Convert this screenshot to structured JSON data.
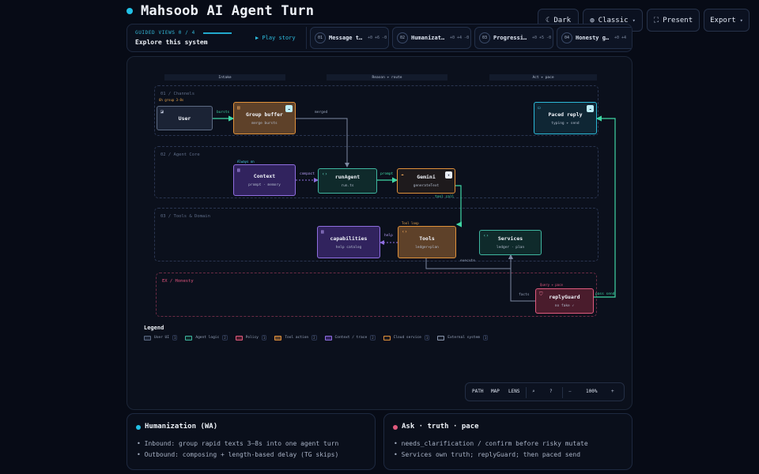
{
  "header": {
    "title": "Mahsoob AI Agent Turn",
    "theme_label": "Dark",
    "style_label": "Classic",
    "present_label": "Present",
    "export_label": "Export"
  },
  "guided": {
    "label": "GUIDED VIEWS",
    "counter": "0 / 4",
    "title": "Explore this system",
    "play_label": "Play story",
    "views": [
      {
        "num": "01",
        "label": "Message to...",
        "stat": "+0 +6 -0"
      },
      {
        "num": "02",
        "label": "Humanizati...",
        "stat": "+0 +4 -0"
      },
      {
        "num": "03",
        "label": "Progressiv...",
        "stat": "+0 +5 -0"
      },
      {
        "num": "04",
        "label": "Honesty ga...",
        "stat": "+0 +4"
      }
    ]
  },
  "diagram": {
    "columns": [
      "Intake",
      "Reason + route",
      "Act + pace"
    ],
    "lanes": {
      "channels": "01 / Channels",
      "core": "02 / Agent Core",
      "tools": "03 / Tools & Domain",
      "honesty": "EX / Honesty"
    },
    "lane_notes": {
      "group": "6h group 3-8s",
      "always_on": "Always on",
      "tool_loop": "Tool loop",
      "query_pace": "Query + pace"
    },
    "nodes": {
      "user": {
        "title": "User",
        "sub": ""
      },
      "group_buffer": {
        "title": "Group buffer",
        "sub": "merge bursts"
      },
      "paced_reply": {
        "title": "Paced reply",
        "sub": "typing + send"
      },
      "context": {
        "title": "Context",
        "sub": "prompt · memory"
      },
      "run_agent": {
        "title": "runAgent",
        "sub": "run.ts"
      },
      "gemini": {
        "title": "Gemini",
        "sub": "generateText"
      },
      "capabilities": {
        "title": "capabilities",
        "sub": "help catalog"
      },
      "tools": {
        "title": "Tools",
        "sub": "ledger+plan"
      },
      "services": {
        "title": "Services",
        "sub": "ledger · plan"
      },
      "reply_guard": {
        "title": "replyGuard",
        "sub": "no fake ✓"
      }
    },
    "edge_labels": {
      "bursts": "bursts",
      "merged": "merged",
      "compact": "compact",
      "prompt": "prompt",
      "tool_call": "tool call",
      "help": "help",
      "execute": "execute",
      "facts": "facts",
      "pass_send": "pass send"
    }
  },
  "legend": {
    "title": "Legend",
    "items": [
      {
        "label": "User UI",
        "count": "1",
        "color": "#5d6b84"
      },
      {
        "label": "Agent logic",
        "count": "2",
        "color": "#3fb6a0"
      },
      {
        "label": "Policy",
        "count": "1",
        "color": "#e05a7e"
      },
      {
        "label": "Tool action",
        "count": "2",
        "color": "#e0913a"
      },
      {
        "label": "Context / trace",
        "count": "2",
        "color": "#8f6ee0"
      },
      {
        "label": "Cloud service",
        "count": "1",
        "color": "#e0913a"
      },
      {
        "label": "External system",
        "count": "1",
        "color": "#8a96ad"
      }
    ]
  },
  "toolbar": {
    "path": "PATH",
    "map": "MAP",
    "lens": "LENS",
    "zoom_out": "−",
    "zoom": "100%",
    "zoom_in": "+"
  },
  "cards": [
    {
      "title": "Humanization (WA)",
      "lines": [
        "• Inbound: group rapid texts 3–8s into one agent turn",
        "• Outbound: composing + length-based delay (TG skips)"
      ]
    },
    {
      "title": "Ask · truth · pace",
      "lines": [
        "• needs_clarification / confirm before risky mutate",
        "• Services own truth; replyGuard; then paced send"
      ]
    }
  ],
  "colors": {
    "accent_cyan": "#22c1e6",
    "tool_orange": "#e0913a",
    "context_purple": "#8f6ee0",
    "agent_teal": "#3fb6a0",
    "policy_rose": "#e05a7e",
    "edge_green": "#3fd6a4"
  }
}
